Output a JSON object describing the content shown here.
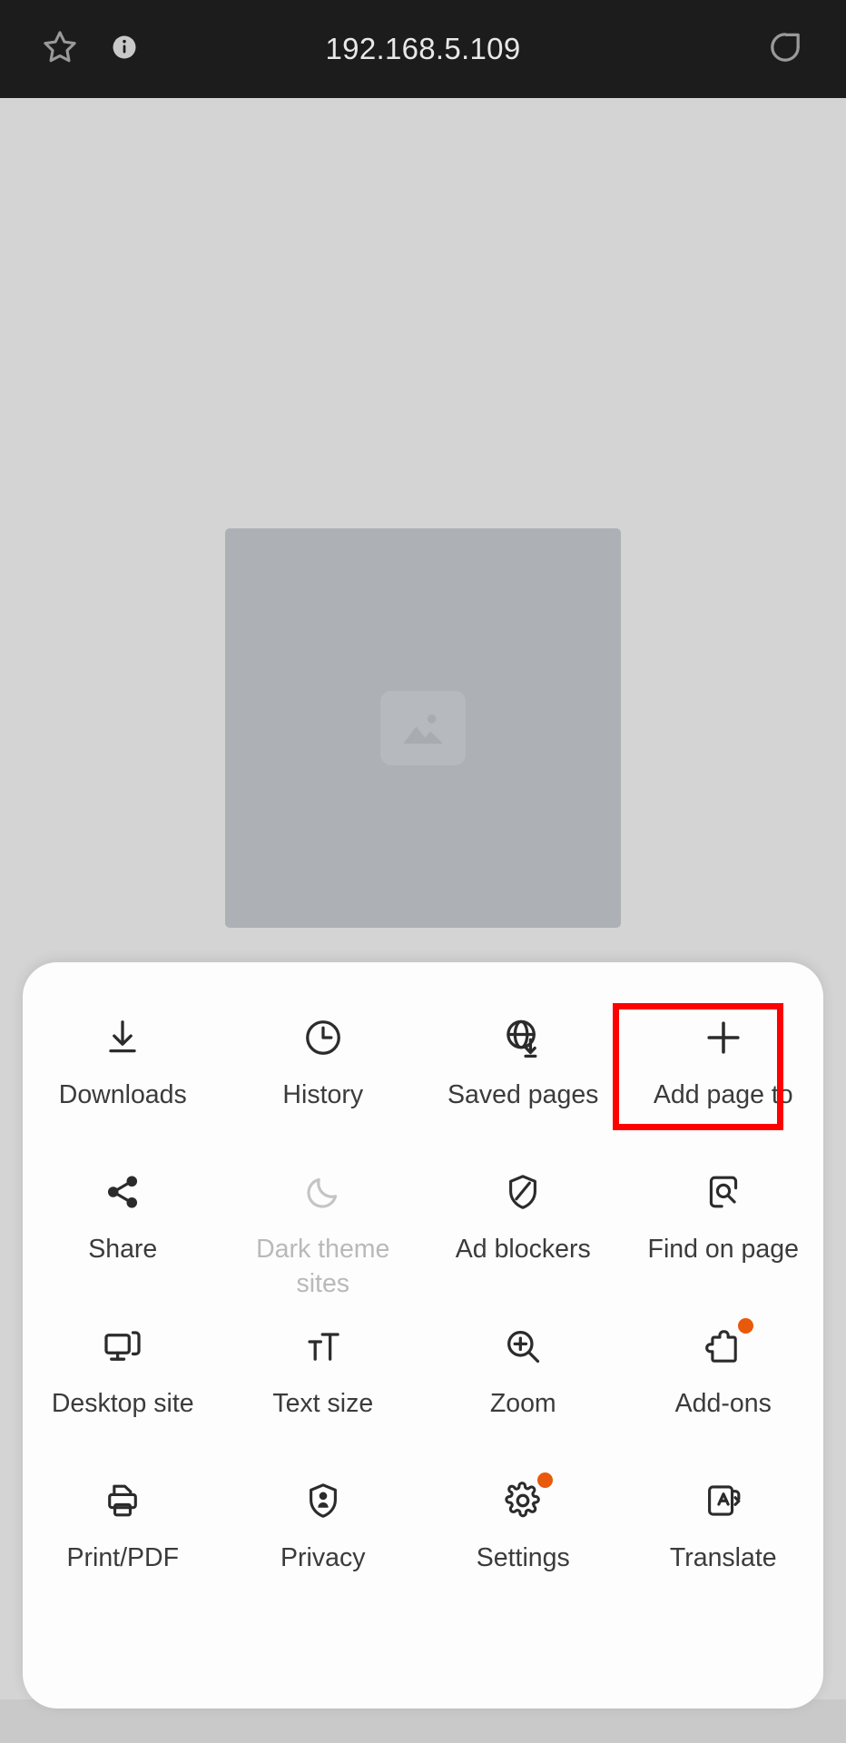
{
  "browser": {
    "url": "192.168.5.109",
    "bookmark_icon": "star-icon",
    "info_icon": "info-icon",
    "reload_icon": "reload-icon"
  },
  "page": {
    "placeholder_icon": "image-placeholder-icon"
  },
  "menu": {
    "items": [
      {
        "label": "Downloads",
        "icon": "download-icon",
        "disabled": false,
        "badge": false,
        "highlighted": false
      },
      {
        "label": "History",
        "icon": "clock-icon",
        "disabled": false,
        "badge": false,
        "highlighted": false
      },
      {
        "label": "Saved pages",
        "icon": "globe-save-icon",
        "disabled": false,
        "badge": false,
        "highlighted": false
      },
      {
        "label": "Add page to",
        "icon": "plus-icon",
        "disabled": false,
        "badge": false,
        "highlighted": true
      },
      {
        "label": "Share",
        "icon": "share-icon",
        "disabled": false,
        "badge": false,
        "highlighted": false
      },
      {
        "label": "Dark theme sites",
        "icon": "moon-icon",
        "disabled": true,
        "badge": false,
        "highlighted": false
      },
      {
        "label": "Ad blockers",
        "icon": "shield-slash-icon",
        "disabled": false,
        "badge": false,
        "highlighted": false
      },
      {
        "label": "Find on page",
        "icon": "find-page-icon",
        "disabled": false,
        "badge": false,
        "highlighted": false
      },
      {
        "label": "Desktop site",
        "icon": "monitor-icon",
        "disabled": false,
        "badge": false,
        "highlighted": false
      },
      {
        "label": "Text size",
        "icon": "text-size-icon",
        "disabled": false,
        "badge": false,
        "highlighted": false
      },
      {
        "label": "Zoom",
        "icon": "zoom-in-icon",
        "disabled": false,
        "badge": false,
        "highlighted": false
      },
      {
        "label": "Add-ons",
        "icon": "puzzle-icon",
        "disabled": false,
        "badge": true,
        "highlighted": false
      },
      {
        "label": "Print/PDF",
        "icon": "printer-icon",
        "disabled": false,
        "badge": false,
        "highlighted": false
      },
      {
        "label": "Privacy",
        "icon": "shield-person-icon",
        "disabled": false,
        "badge": false,
        "highlighted": false
      },
      {
        "label": "Settings",
        "icon": "gear-icon",
        "disabled": false,
        "badge": true,
        "highlighted": false
      },
      {
        "label": "Translate",
        "icon": "translate-icon",
        "disabled": false,
        "badge": false,
        "highlighted": false
      }
    ]
  },
  "colors": {
    "toolbar_bg": "#1c1c1c",
    "page_bg": "#d4d4d4",
    "sheet_bg": "#fdfdfd",
    "icon": "#2b2b2b",
    "label": "#3b3b3b",
    "disabled": "#b9b9b9",
    "badge": "#e8590c",
    "highlight": "#ff0000"
  }
}
